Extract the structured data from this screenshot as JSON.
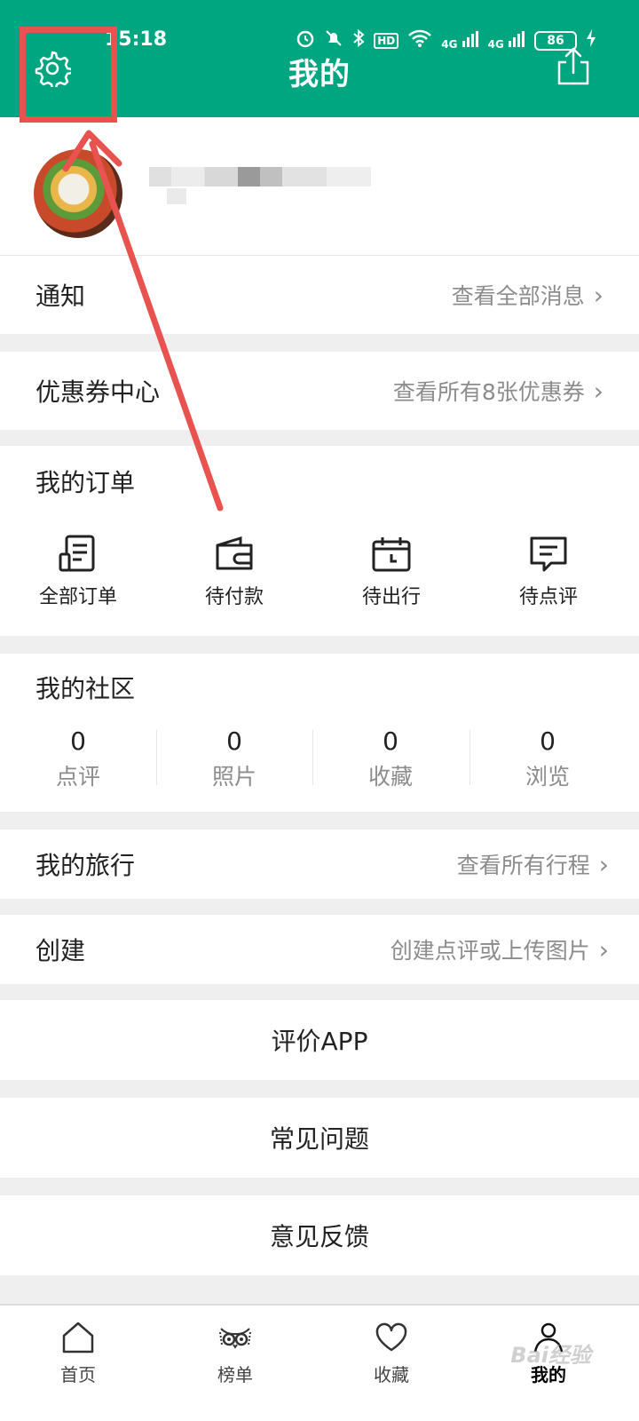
{
  "status_bar": {
    "time": "15:18",
    "icons": [
      "alarm-icon",
      "bell-off-icon",
      "bluetooth-icon",
      "hd-icon",
      "wifi-icon",
      "signal-4g-icon",
      "signal-4g-icon"
    ],
    "hd": "HD",
    "network_1": "4G",
    "network_2": "4G",
    "battery": "86"
  },
  "header": {
    "title": "我的",
    "bg_color": "#00a680"
  },
  "notification": {
    "label": "通知",
    "link": "查看全部消息"
  },
  "coupons": {
    "label": "优惠券中心",
    "link": "查看所有8张优惠券"
  },
  "orders": {
    "title": "我的订单",
    "items": [
      {
        "label": "全部订单",
        "icon": "order-list-icon"
      },
      {
        "label": "待付款",
        "icon": "wallet-icon"
      },
      {
        "label": "待出行",
        "icon": "calendar-icon"
      },
      {
        "label": "待点评",
        "icon": "comment-icon"
      }
    ]
  },
  "community": {
    "title": "我的社区",
    "stats": [
      {
        "value": "0",
        "label": "点评"
      },
      {
        "value": "0",
        "label": "照片"
      },
      {
        "value": "0",
        "label": "收藏"
      },
      {
        "value": "0",
        "label": "浏览"
      }
    ]
  },
  "trips": {
    "label": "我的旅行",
    "link": "查看所有行程"
  },
  "create": {
    "label": "创建",
    "link": "创建点评或上传图片"
  },
  "actions": {
    "rate_app": "评价APP",
    "faq": "常见问题",
    "feedback": "意见反馈"
  },
  "tabbar": {
    "items": [
      {
        "label": "首页",
        "icon": "home-icon"
      },
      {
        "label": "榜单",
        "icon": "owl-icon"
      },
      {
        "label": "收藏",
        "icon": "heart-icon"
      },
      {
        "label": "我的",
        "icon": "person-icon",
        "active": true
      }
    ]
  },
  "watermark": "Bai经验",
  "annotation_color": "#e8534f"
}
